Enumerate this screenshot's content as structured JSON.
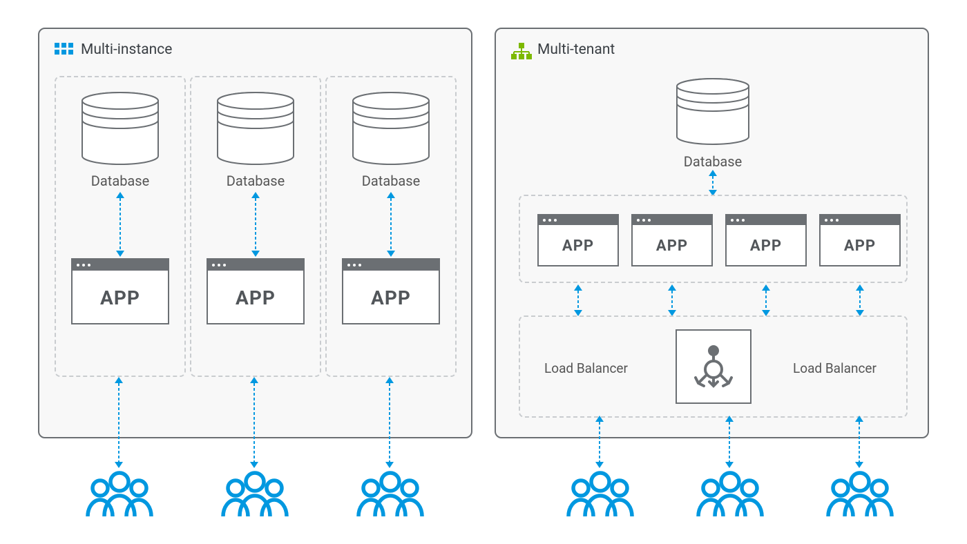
{
  "colors": {
    "accent_blue": "#0098e0",
    "accent_green": "#7db900",
    "panel_border": "#6b6f73",
    "panel_bg": "#f8f8f8",
    "dashed": "#c9cccf",
    "text": "#3a3f44"
  },
  "left_panel": {
    "title": "Multi-instance",
    "icon": "multi-instance-icon",
    "instances": [
      {
        "database_label": "Database",
        "app_label": "APP"
      },
      {
        "database_label": "Database",
        "app_label": "APP"
      },
      {
        "database_label": "Database",
        "app_label": "APP"
      }
    ],
    "user_groups": 3
  },
  "right_panel": {
    "title": "Multi-tenant",
    "icon": "multi-tenant-icon",
    "database_label": "Database",
    "apps": [
      {
        "label": "APP"
      },
      {
        "label": "APP"
      },
      {
        "label": "APP"
      },
      {
        "label": "APP"
      }
    ],
    "load_balancer": {
      "left_label": "Load Balancer",
      "right_label": "Load Balancer",
      "icon": "load-balancer-icon"
    },
    "user_groups": 3
  }
}
